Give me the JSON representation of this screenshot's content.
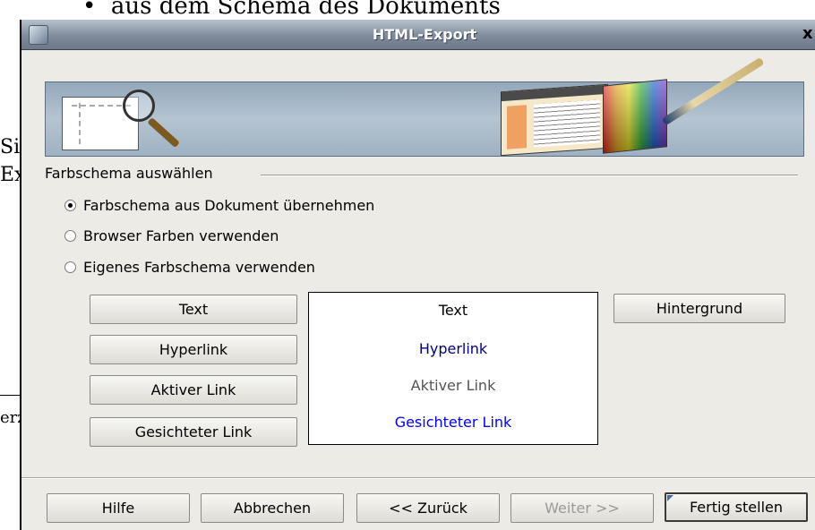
{
  "background": {
    "bullet_text": "aus dem Schema des Dokuments",
    "fragment_1": "Si",
    "fragment_2": "Ex",
    "fragment_3": "erz"
  },
  "window": {
    "title": "HTML-Export",
    "close_glyph": "x"
  },
  "banner": {
    "icons": [
      "document-magnifier-icon",
      "browser-page-icon",
      "color-palette-icon",
      "paintbrush-icon"
    ]
  },
  "colorscheme": {
    "section_title": "Farbschema auswählen",
    "options": [
      {
        "label": "Farbschema aus Dokument übernehmen",
        "selected": true
      },
      {
        "label": "Browser Farben verwenden",
        "selected": false
      },
      {
        "label": "Eigenes Farbschema verwenden",
        "selected": false
      }
    ],
    "buttons": {
      "text": "Text",
      "hyperlink": "Hyperlink",
      "active_link": "Aktiver Link",
      "visited_link": "Gesichteter Link",
      "background": "Hintergrund"
    },
    "preview": {
      "text": "Text",
      "hyperlink": "Hyperlink",
      "active_link": "Aktiver Link",
      "visited_link": "Gesichteter Link"
    },
    "colors": {
      "text": "#000000",
      "hyperlink": "#000080",
      "active_link": "#555555",
      "visited_link": "#0000ff"
    }
  },
  "footer": {
    "help": "Hilfe",
    "cancel": "Abbrechen",
    "back": "<< Zurück",
    "next": "Weiter >>",
    "finish": "Fertig stellen"
  }
}
